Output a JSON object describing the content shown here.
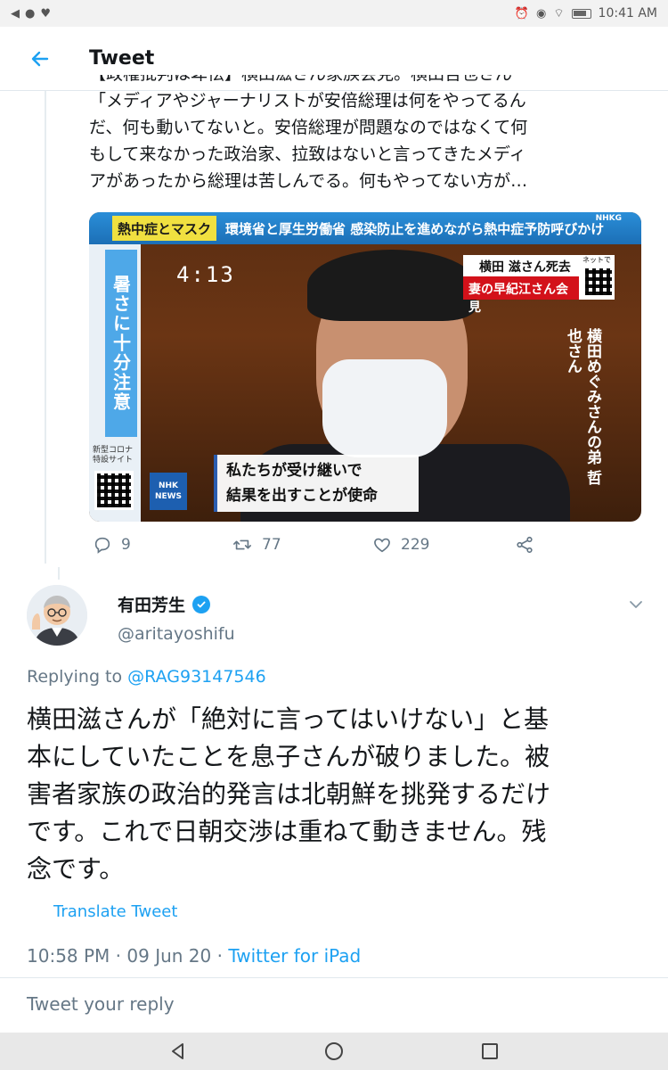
{
  "status_bar": {
    "time": "10:41 AM"
  },
  "header": {
    "title": "Tweet"
  },
  "quoted_tweet": {
    "lines": [
      "【政権批判は卑怯】横田滋さん家族会見。横田哲也さん",
      "「メディアやジャーナリストが安倍総理は何をやってるん",
      "だ、何も動いてないと。安倍総理が問題なのではなくて何",
      "もして来なかった政治家、拉致はないと言ってきたメディ",
      "アがあったから総理は苦しんでる。何もやってない方が…"
    ],
    "media": {
      "ticker_tag": "熱中症とマスク",
      "ticker_text": "環境省と厚生労働省 感染防止を進めながら熱中症予防呼びかけ",
      "side_banner": "暑さに十分注意",
      "side_caption": "新型コロナ特設サイト",
      "clock": "4:13",
      "name_top": "横田 滋さん死去",
      "name_bottom": "妻の早紀江さん会見",
      "net_label": "ネットでも",
      "nhk_top": "NHK",
      "nhk_corner": "NHKG",
      "nhk_bottom": "NEWS",
      "vertical_caption": "横田めぐみさんの弟 哲也さん",
      "subtitle_line1": "私たちが受け継いで",
      "subtitle_line2": "結果を出すことが使命"
    },
    "actions": {
      "replies": "9",
      "retweets": "77",
      "likes": "229"
    }
  },
  "tweet": {
    "author_name": "有田芳生",
    "handle": "@aritayoshifu",
    "replying_prefix": "Replying to",
    "replying_to": "@RAG93147546",
    "body_lines": [
      "横田滋さんが「絶対に言ってはいけない」と基",
      "本にしていたことを息子さんが破りました。被",
      "害者家族の政治的発言は北朝鮮を挑発するだけ",
      "です。これで日朝交渉は重ねて動きません。残",
      "念です。"
    ],
    "translate_label": "Translate Tweet",
    "timestamp": "10:58 PM · 09 Jun 20 · ",
    "source": "Twitter for iPad"
  },
  "reply": {
    "placeholder": "Tweet your reply"
  },
  "colors": {
    "accent": "#1da1f2",
    "secondary_text": "#657786",
    "primary_text": "#14171a"
  }
}
